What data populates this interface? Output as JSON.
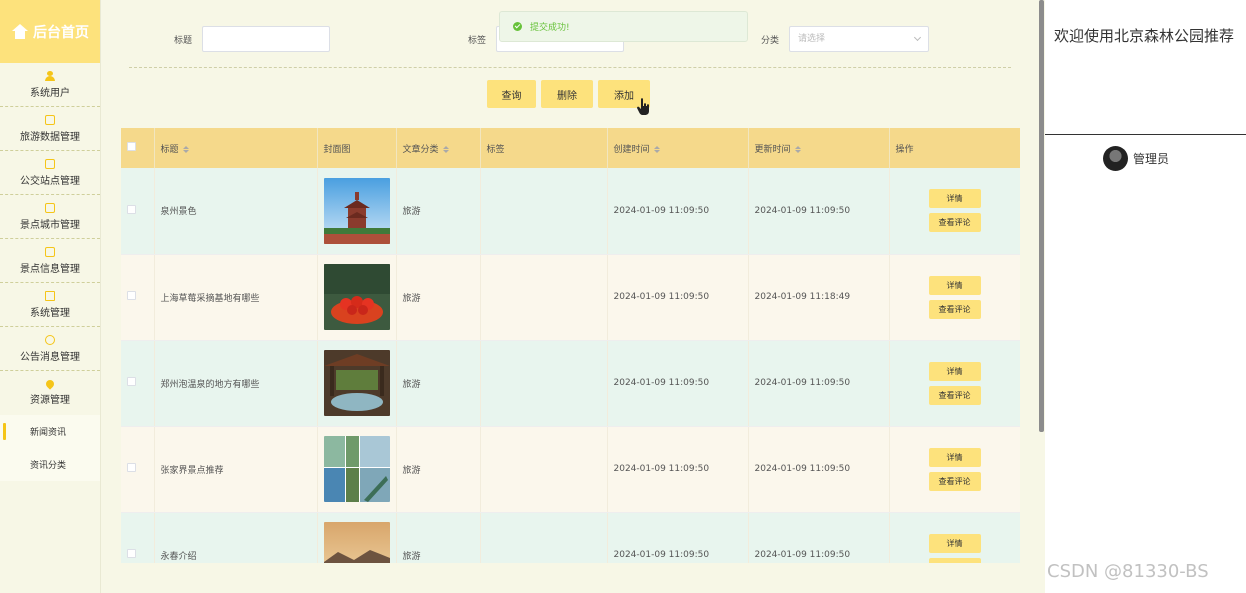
{
  "sidebar": {
    "title": "后台首页",
    "items": [
      {
        "label": "系统用户"
      },
      {
        "label": "旅游数据管理"
      },
      {
        "label": "公交站点管理"
      },
      {
        "label": "景点城市管理"
      },
      {
        "label": "景点信息管理"
      },
      {
        "label": "系统管理"
      },
      {
        "label": "公告消息管理"
      },
      {
        "label": "资源管理"
      }
    ],
    "subitems": [
      {
        "label": "新闻资讯",
        "active": true
      },
      {
        "label": "资讯分类",
        "active": false
      }
    ]
  },
  "search": {
    "title_label": "标题",
    "tag_label": "标签",
    "category_label": "分类",
    "category_placeholder": "请选择"
  },
  "buttons": {
    "query": "查询",
    "delete": "删除",
    "add": "添加"
  },
  "toast": {
    "message": "提交成功!"
  },
  "table": {
    "headers": [
      "标题",
      "封面图",
      "文章分类",
      "标签",
      "创建时间",
      "更新时间",
      "操作"
    ],
    "rows": [
      {
        "title": "泉州景色",
        "category": "旅游",
        "tag": "",
        "created": "2024-01-09 11:09:50",
        "updated": "2024-01-09 11:09:50"
      },
      {
        "title": "上海草莓采摘基地有哪些",
        "category": "旅游",
        "tag": "",
        "created": "2024-01-09 11:09:50",
        "updated": "2024-01-09 11:18:49"
      },
      {
        "title": "郑州泡温泉的地方有哪些",
        "category": "旅游",
        "tag": "",
        "created": "2024-01-09 11:09:50",
        "updated": "2024-01-09 11:09:50"
      },
      {
        "title": "张家界景点推荐",
        "category": "旅游",
        "tag": "",
        "created": "2024-01-09 11:09:50",
        "updated": "2024-01-09 11:09:50"
      },
      {
        "title": "永春介绍",
        "category": "旅游",
        "tag": "",
        "created": "2024-01-09 11:09:50",
        "updated": "2024-01-09 11:09:50"
      }
    ],
    "detail_label": "详情",
    "comments_label": "查看评论"
  },
  "header_right": {
    "welcome": "欢迎使用北京森林公园推荐",
    "user": "管理员"
  },
  "watermark": "CSDN @81330-BS",
  "colors": {
    "accent": "#fde27c",
    "table_header": "#f5d98b",
    "row_green": "#e8f5ee",
    "row_beige": "#fbf7ec",
    "success": "#67c23a"
  }
}
